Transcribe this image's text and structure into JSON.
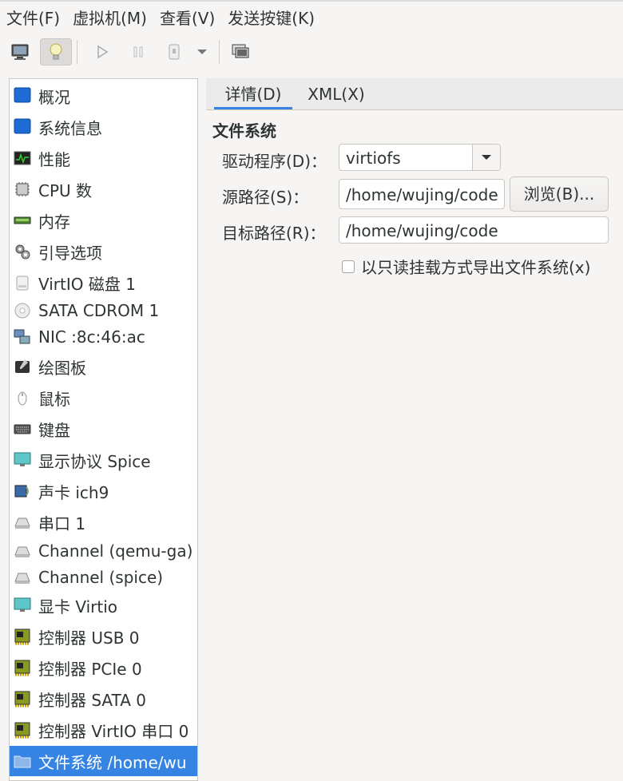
{
  "menubar": {
    "items": [
      "文件(F)",
      "虚拟机(M)",
      "查看(V)",
      "发送按键(K)"
    ]
  },
  "toolbar": {
    "buttons": [
      "console-icon",
      "details-icon",
      "run-icon",
      "pause-icon",
      "shutdown-icon",
      "dropdown-icon",
      "snapshots-icon"
    ]
  },
  "sidebar": {
    "items": [
      {
        "label": "概况",
        "icon": "overview-icon"
      },
      {
        "label": "系统信息",
        "icon": "os-icon"
      },
      {
        "label": "性能",
        "icon": "performance-icon"
      },
      {
        "label": "CPU 数",
        "icon": "cpu-icon"
      },
      {
        "label": "内存",
        "icon": "memory-icon"
      },
      {
        "label": "引导选项",
        "icon": "boot-icon"
      },
      {
        "label": "VirtIO 磁盘 1",
        "icon": "disk-icon"
      },
      {
        "label": "SATA CDROM 1",
        "icon": "cdrom-icon"
      },
      {
        "label": "NIC :8c:46:ac",
        "icon": "nic-icon"
      },
      {
        "label": "绘图板",
        "icon": "tablet-icon"
      },
      {
        "label": "鼠标",
        "icon": "mouse-icon"
      },
      {
        "label": "键盘",
        "icon": "keyboard-icon"
      },
      {
        "label": "显示协议 Spice",
        "icon": "display-icon"
      },
      {
        "label": "声卡 ich9",
        "icon": "sound-icon"
      },
      {
        "label": "串口 1",
        "icon": "serial-icon"
      },
      {
        "label": "Channel (qemu-ga)",
        "icon": "channel-icon"
      },
      {
        "label": "Channel (spice)",
        "icon": "channel-icon"
      },
      {
        "label": "显卡 Virtio",
        "icon": "video-icon"
      },
      {
        "label": "控制器 USB 0",
        "icon": "controller-icon"
      },
      {
        "label": "控制器 PCIe 0",
        "icon": "controller-icon"
      },
      {
        "label": "控制器 SATA 0",
        "icon": "controller-icon"
      },
      {
        "label": "控制器 VirtIO 串口 0",
        "icon": "controller-icon"
      },
      {
        "label": "文件系统 /home/wu",
        "icon": "folder-icon"
      }
    ],
    "selected_index": 22
  },
  "tabs": [
    "详情(D)",
    "XML(X)"
  ],
  "filesystem": {
    "section_title": "文件系统",
    "driver_label": "驱动程序(D)：",
    "driver_value": "virtiofs",
    "source_label": "源路径(S)：",
    "source_value": "/home/wujing/code",
    "browse_label": "浏览(B)...",
    "target_label": "目标路径(R)：",
    "target_value": "/home/wujing/code",
    "readonly_label": "以只读挂载方式导出文件系统(x)",
    "readonly_checked": false
  },
  "colors": {
    "accent": "#3584e4",
    "background": "#f6f5f4",
    "selected_text": "#ffffff"
  }
}
